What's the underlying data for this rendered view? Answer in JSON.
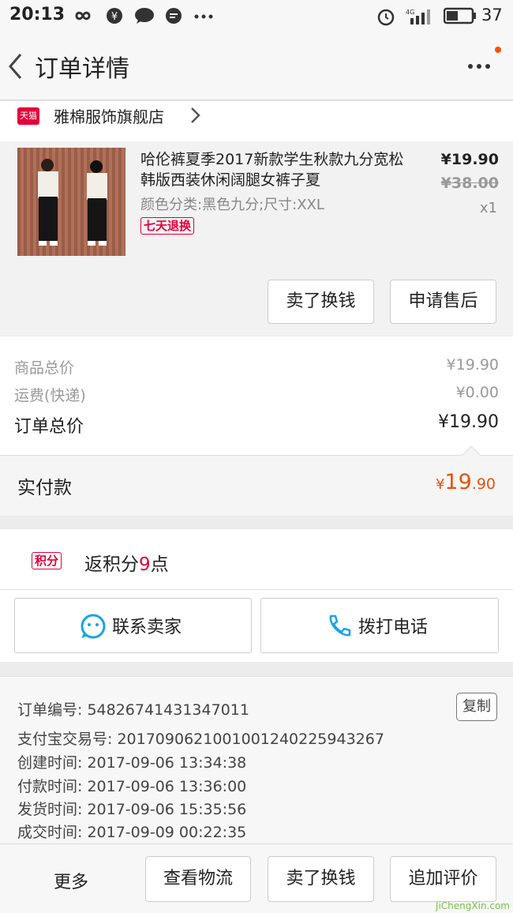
{
  "status_bar": {
    "time": "20:13",
    "battery": "37",
    "network": "4G"
  },
  "nav": {
    "title": "订单详情"
  },
  "shop": {
    "badge": "天猫",
    "name": "雅棉服饰旗舰店"
  },
  "product": {
    "title": "哈伦裤夏季2017新款学生秋款九分宽松韩版西装休闲阔腿女裤子夏",
    "spec": "颜色分类:黑色九分;尺寸:XXL",
    "badge": "七天退换",
    "price": "¥19.90",
    "original_price": "¥38.00",
    "quantity": "x1"
  },
  "product_actions": {
    "sell_label": "卖了换钱",
    "after_sale_label": "申请售后"
  },
  "totals": {
    "goods_label": "商品总价",
    "goods_value": "¥19.90",
    "shipping_label": "运费(快递)",
    "shipping_value": "¥0.00",
    "order_label": "订单总价",
    "order_value": "¥19.90"
  },
  "paid": {
    "label": "实付款",
    "currency": "¥",
    "integer": "19",
    "decimal": ".90"
  },
  "points": {
    "badge": "积分",
    "prefix": "返积分",
    "value": "9",
    "suffix": "点"
  },
  "contact": {
    "seller_label": "联系卖家",
    "call_label": "拨打电话"
  },
  "order_info": {
    "copy_label": "复制",
    "lines": [
      {
        "label": "订单编号:",
        "value": "54826741431347011"
      },
      {
        "label": "支付宝交易号:",
        "value": "2017090621001001240225943267"
      },
      {
        "label": "创建时间:",
        "value": "2017-09-06 13:34:38"
      },
      {
        "label": "付款时间:",
        "value": "2017-09-06 13:36:00"
      },
      {
        "label": "发货时间:",
        "value": "2017-09-06 15:35:56"
      },
      {
        "label": "成交时间:",
        "value": "2017-09-09 00:22:35"
      }
    ]
  },
  "bottom_bar": {
    "more": "更多",
    "logistics": "查看物流",
    "sell": "卖了换钱",
    "review": "追加评价"
  },
  "watermark": "JiChengXin.com",
  "colors": {
    "accent": "#ff5000",
    "tmall_red": "#e4003a",
    "price_orange": "#e8520c"
  }
}
